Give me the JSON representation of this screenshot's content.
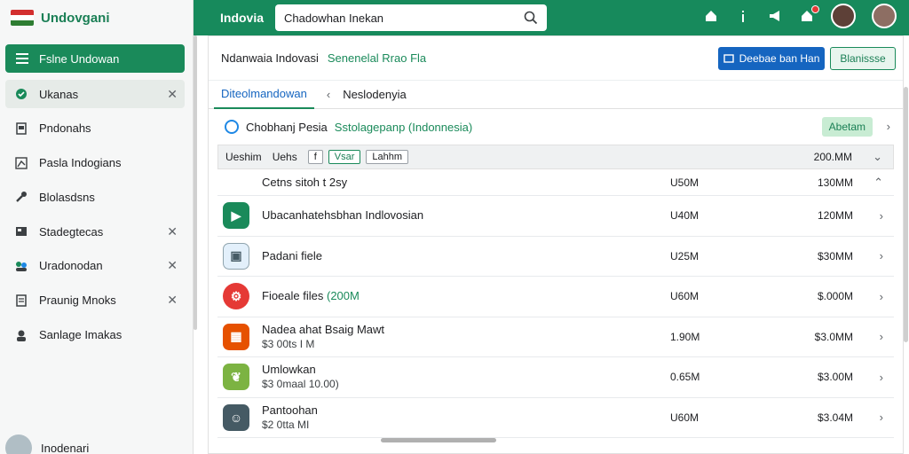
{
  "brand": {
    "name": "Undovgani",
    "flag_colors": [
      "#d32f2f",
      "#ffffff",
      "#2e7d32"
    ]
  },
  "sidebar": {
    "primary_button": "Fslne Undowan",
    "items": [
      {
        "label": "Ukanas",
        "icon": "circle-badge-icon",
        "closable": true,
        "active": true
      },
      {
        "label": "Pndonahs",
        "icon": "document-icon",
        "closable": false
      },
      {
        "label": "Pasla Indogians",
        "icon": "chart-icon",
        "closable": false
      },
      {
        "label": "Blolasdsns",
        "icon": "wrench-icon",
        "closable": false
      },
      {
        "label": "Stadegtecas",
        "icon": "card-icon",
        "closable": true
      },
      {
        "label": "Uradonodan",
        "icon": "people-icon",
        "closable": true
      },
      {
        "label": "Praunig Mnoks",
        "icon": "page-icon",
        "closable": true
      },
      {
        "label": "Sanlage Imakas",
        "icon": "user-gear-icon",
        "closable": false
      }
    ],
    "profile_name": "Inodenari"
  },
  "topbar": {
    "title": "Indovia",
    "search_value": "Chadowhan Inekan"
  },
  "toolbar": {
    "breadcrumb_main": "Ndanwaia Indovasi",
    "breadcrumb_sub": "Senenelal Rrao Fla",
    "blue_button": "Deebae ban Han",
    "outline_button": "Blanissse"
  },
  "tabs": {
    "active": "Diteolmandowan",
    "second": "Neslodenyia"
  },
  "info": {
    "title": "Chobhanj Pesia",
    "subtitle": "Sstolagepanp (Indonnesia)",
    "action": "Abetam"
  },
  "table": {
    "headers": [
      "Ueshim",
      "Uehs"
    ],
    "chips": [
      "f",
      "Vsar",
      "Lahhm"
    ],
    "total": "200.MM",
    "rows": [
      {
        "name": "Cetns sitoh t 2sy",
        "sub": "",
        "size": "U50M",
        "total": "130MM",
        "icon": "",
        "icon_color": ""
      },
      {
        "name": "Ubacanhatehsbhan Indlovosian",
        "sub": "",
        "size": "U40M",
        "total": "120MM",
        "icon": "play-icon",
        "icon_color": "#1a8a5a"
      },
      {
        "name": "Padani fiele",
        "sub": "",
        "size": "U25M",
        "total": "$30MM",
        "icon": "image-icon",
        "icon_color": "#e3f0fb"
      },
      {
        "name": "Fioeale files",
        "highlight": "(200M",
        "sub": "",
        "size": "U60M",
        "total": "$.000M",
        "icon": "gear-icon",
        "icon_color": "#e53935"
      },
      {
        "name": "Nadea ahat Bsaig Mawt",
        "sub": "$3 00ts I M",
        "size": "1.90M",
        "total": "$3.0MM",
        "icon": "game-icon",
        "icon_color": "#e65100"
      },
      {
        "name": "Umlowkan",
        "sub": "$3 0maal 10.00)",
        "size": "0.65M",
        "total": "$3.00M",
        "icon": "leaf-icon",
        "icon_color": "#7cb342"
      },
      {
        "name": "Pantoohan",
        "sub": "$2 0tta MI",
        "size": "U60M",
        "total": "$3.04M",
        "icon": "photo-icon",
        "icon_color": "#455a64"
      }
    ]
  }
}
